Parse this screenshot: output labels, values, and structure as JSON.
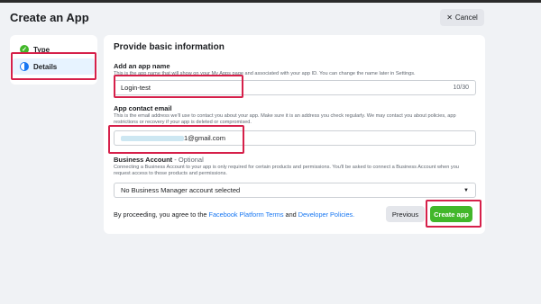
{
  "page": {
    "title": "Create an App"
  },
  "header": {
    "cancel_label": "Cancel"
  },
  "sidebar": {
    "items": [
      {
        "label": "Type",
        "state": "complete"
      },
      {
        "label": "Details",
        "state": "active"
      }
    ]
  },
  "form": {
    "heading": "Provide basic information",
    "app_name": {
      "label": "Add an app name",
      "help": "This is the app name that will show on your My Apps page and associated with your app ID. You can change the name later in Settings.",
      "value": "Login-test",
      "counter": "10/30"
    },
    "contact_email": {
      "label": "App contact email",
      "help": "This is the email address we'll use to contact you about your app. Make sure it is an address you check regularly. We may contact you about policies, app restrictions or recovery if your app is deleted or compromised.",
      "value_suffix": "1@gmail.com"
    },
    "business_account": {
      "label": "Business Account",
      "optional_label": "- Optional",
      "help": "Connecting a Business Account to your app is only required for certain products and permissions. You'll be asked to connect a Business Account when you request access to those products and permissions.",
      "selected": "No Business Manager account selected"
    },
    "footer": {
      "prefix": "By proceeding, you agree to the",
      "terms_link": "Facebook Platform Terms",
      "and": "and",
      "policies_link": "Developer Policies."
    },
    "previous_label": "Previous",
    "create_label": "Create app"
  },
  "colors": {
    "accent": "#1877f2",
    "success": "#42b72a",
    "highlight": "#d6204a"
  }
}
